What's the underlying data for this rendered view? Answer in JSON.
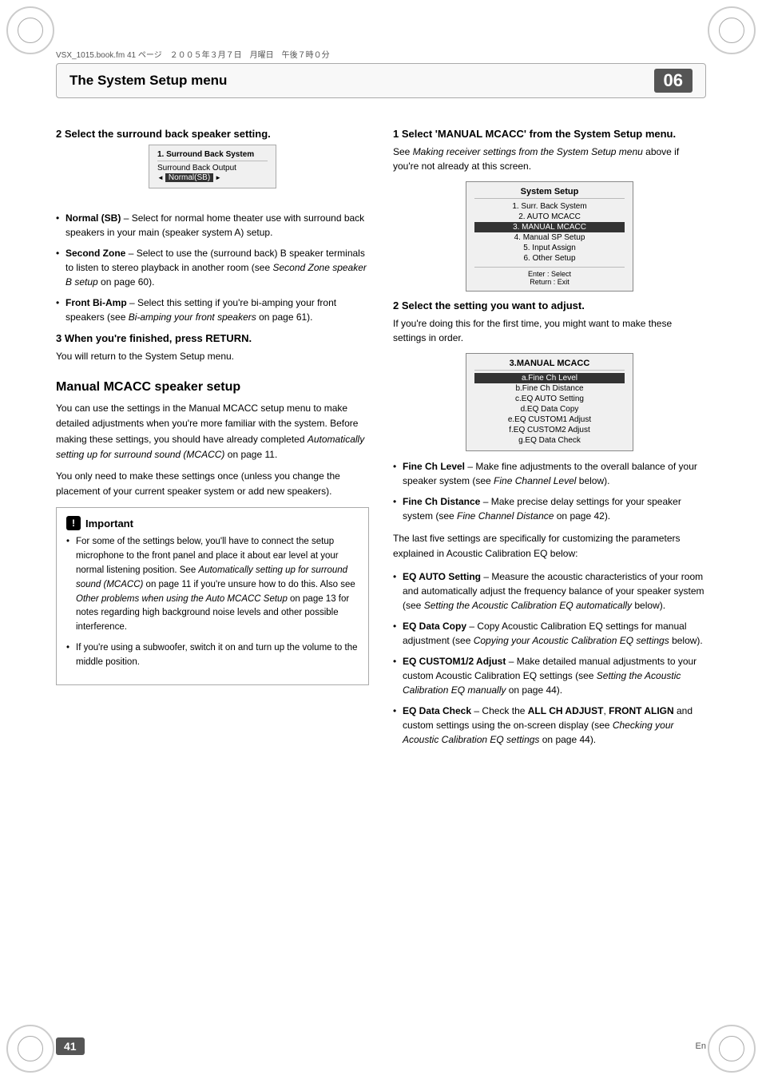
{
  "page": {
    "file_path": "VSX_1015.book.fm  41 ページ　２００５年３月７日　月曜日　午後７時０分",
    "chapter_number": "06",
    "page_number": "41",
    "page_lang": "En"
  },
  "header": {
    "title": "The System Setup menu"
  },
  "left_column": {
    "step2_heading": "2   Select the surround back speaker setting.",
    "display1": {
      "title": "1. Surround Back System",
      "label": "Surround Back Output",
      "value": "Normal(SB)",
      "has_arrows": true
    },
    "bullets": [
      {
        "term": "Normal (SB)",
        "text": "– Select for normal home theater use with surround back speakers in your main (speaker system A) setup."
      },
      {
        "term": "Second Zone",
        "text": "– Select to use the (surround back) B speaker terminals to listen to stereo playback in another room (see Second Zone speaker B setup on page 60)."
      },
      {
        "term": "Front Bi-Amp",
        "text": "– Select this setting if you're bi-amping your front speakers (see Bi-amping your front speakers on page 61)."
      }
    ],
    "step3_heading": "3   When you're finished, press RETURN.",
    "step3_text": "You will return to the System Setup menu.",
    "section_heading": "Manual MCACC speaker setup",
    "section_body1": "You can use the settings in the Manual MCACC setup menu to make detailed adjustments when you're more familiar with the system. Before making these settings, you should have already completed Automatically setting up for surround sound (MCACC) on page 11.",
    "section_body2": "You only need to make these settings once (unless you change the placement of your current speaker system or add new speakers).",
    "important": {
      "title": "Important",
      "bullets": [
        "For some of the settings below, you'll have to connect the setup microphone to the front panel and place it about ear level at your normal listening position. See Automatically setting up for surround sound (MCACC) on page 11 if you're unsure how to do this. Also see Other problems when using the Auto MCACC Setup on page 13 for notes regarding high background noise levels and other possible interference.",
        "If you're using a subwoofer, switch it on and turn up the volume to the middle position."
      ]
    }
  },
  "right_column": {
    "step1_heading": "1   Select 'MANUAL MCACC' from the System Setup menu.",
    "step1_subtext": "See Making receiver settings from the System Setup menu above if you're not already at this screen.",
    "system_display": {
      "title": "System Setup",
      "items": [
        "1. Surr. Back System",
        "2. AUTO  MCACC",
        "3. MANUAL MCACC",
        "4. Manual  SP Setup",
        "5. Input  Assign",
        "6. Other  Setup"
      ],
      "highlighted_index": 2,
      "footer": "Enter  : Select\nReturn : Exit"
    },
    "step2_heading": "2   Select the setting you want to adjust.",
    "step2_subtext": "If you're doing this for the first time, you might want to make these settings in order.",
    "manual_display": {
      "title": "3.MANUAL MCACC",
      "items": [
        "a.Fine Ch Level",
        "b.Fine Ch Distance",
        "c.EQ AUTO Setting",
        "d.EQ Data Copy",
        "e.EQ CUSTOM1 Adjust",
        "f.EQ CUSTOM2 Adjust",
        "g.EQ Data Check"
      ],
      "highlighted_index": 0
    },
    "bullets": [
      {
        "term": "Fine Ch Level",
        "text": "– Make fine adjustments to the overall balance of your speaker system (see Fine Channel Level below)."
      },
      {
        "term": "Fine Ch Distance",
        "text": "– Make precise delay settings for your speaker system (see Fine Channel Distance on page 42)."
      }
    ],
    "last_five_intro": "The last five settings are specifically for customizing the parameters explained in Acoustic Calibration EQ below:",
    "last_five_bullets": [
      {
        "term": "EQ AUTO Setting",
        "text": "– Measure the acoustic characteristics of your room and automatically adjust the frequency balance of your speaker system (see Setting the Acoustic Calibration EQ automatically below)."
      },
      {
        "term": "EQ Data Copy",
        "text": "– Copy Acoustic Calibration EQ settings for manual adjustment (see Copying your Acoustic Calibration EQ settings below)."
      },
      {
        "term": "EQ CUSTOM1/2 Adjust",
        "text": "– Make detailed manual adjustments to your custom Acoustic Calibration EQ settings (see Setting the Acoustic Calibration EQ manually on page 44)."
      },
      {
        "term": "EQ Data Check",
        "text": "– Check the ALL CH ADJUST, FRONT ALIGN and custom settings using the on-screen display (see Checking your Acoustic Calibration EQ settings on page 44)."
      }
    ]
  }
}
